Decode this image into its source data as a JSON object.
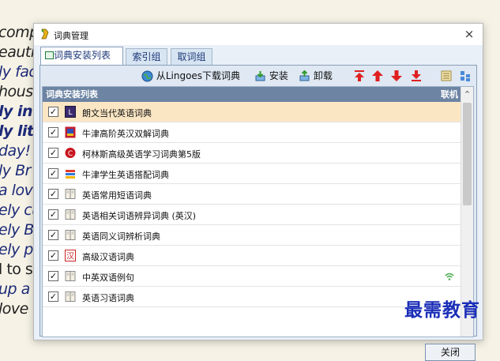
{
  "background_text": [
    "comp",
    "eautif",
    "ly fac",
    "house",
    "ly in",
    "ly lit",
    "day!",
    "ly Br",
    "a love",
    "ely cu",
    "ely Br",
    "ely pe",
    "l to s",
    "up a",
    "love"
  ],
  "window": {
    "title": "词典管理",
    "close_glyph": "×"
  },
  "tabs": [
    {
      "label": "词典安装列表",
      "active": true
    },
    {
      "label": "索引组",
      "active": false
    },
    {
      "label": "取词组",
      "active": false
    }
  ],
  "toolbar": {
    "download_label": "从Lingoes下载词典",
    "install_label": "安装",
    "uninstall_label": "卸载",
    "icons": [
      "move-top-icon",
      "move-up-icon",
      "move-down-icon",
      "move-bottom-icon",
      "list-view-icon",
      "grid-view-icon"
    ],
    "arrow_color": "#e02020"
  },
  "table": {
    "header_name": "词典安装列表",
    "header_online": "联机",
    "rows": [
      {
        "name": "朗文当代英语词典",
        "checked": true,
        "icon": "longman-icon",
        "selected": true,
        "online": false
      },
      {
        "name": "牛津高阶英汉双解词典",
        "checked": true,
        "icon": "oxford-icon",
        "selected": false,
        "online": false
      },
      {
        "name": "柯林斯高级英语学习词典第5版",
        "checked": true,
        "icon": "collins-icon",
        "selected": false,
        "online": false
      },
      {
        "name": "牛津学生英语搭配词典",
        "checked": true,
        "icon": "oxford-collocation-icon",
        "selected": false,
        "online": false
      },
      {
        "name": "英语常用短语词典",
        "checked": true,
        "icon": "book-icon",
        "selected": false,
        "online": false
      },
      {
        "name": "英语相关词语辨异词典 (英汉)",
        "checked": true,
        "icon": "book-icon",
        "selected": false,
        "online": false
      },
      {
        "name": "英语同义词辨析词典",
        "checked": true,
        "icon": "book-icon",
        "selected": false,
        "online": false
      },
      {
        "name": "高级汉语词典",
        "checked": true,
        "icon": "chinese-dict-icon",
        "selected": false,
        "online": false
      },
      {
        "name": "中英双语例句",
        "checked": true,
        "icon": "book-icon",
        "selected": false,
        "online": true
      },
      {
        "name": "英语习语词典",
        "checked": true,
        "icon": "book-icon",
        "selected": false,
        "online": false
      }
    ]
  },
  "footer": {
    "close_label": "关闭"
  },
  "watermark": "最需教育",
  "colors": {
    "header_bg": "#6d84a3",
    "selected_row": "#fbe6c4",
    "panel_bg": "#dfe8f3"
  }
}
